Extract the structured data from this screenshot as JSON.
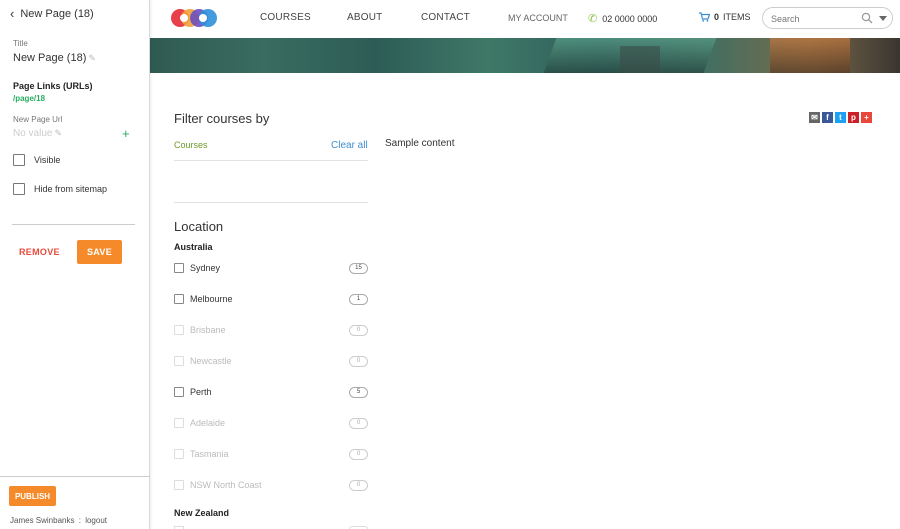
{
  "sidebar": {
    "back_label": "New Page (18)",
    "title_label": "Title",
    "title_value": "New Page (18)",
    "page_links_heading": "Page Links (URLs)",
    "page_link_path": "/page/18",
    "new_url_label": "New Page Url",
    "new_url_placeholder": "No value",
    "add_icon": "plus-icon",
    "visible_label": "Visible",
    "visible_checked": false,
    "hide_sitemap_label": "Hide from sitemap",
    "hide_sitemap_checked": false,
    "remove_label": "REMOVE",
    "save_label": "SAVE",
    "publish_label": "PUBLISH",
    "user_name": "James Swinbanks",
    "user_separator": ":",
    "logout_label": "logout"
  },
  "header": {
    "nav": [
      "COURSES",
      "ABOUT",
      "CONTACT"
    ],
    "my_account": "MY ACCOUNT",
    "phone": "02 0000 0000",
    "cart_count": "0",
    "cart_label": "ITEMS",
    "search_placeholder": "Search"
  },
  "filter": {
    "title": "Filter courses by",
    "subtitle": "Courses",
    "clear_all": "Clear all",
    "location_title": "Location",
    "regions": [
      {
        "name": "Australia",
        "locations": [
          {
            "name": "Sydney",
            "count": "15",
            "enabled": true
          },
          {
            "name": "Melbourne",
            "count": "1",
            "enabled": true
          },
          {
            "name": "Brisbane",
            "count": "0",
            "enabled": false
          },
          {
            "name": "Newcastle",
            "count": "0",
            "enabled": false
          },
          {
            "name": "Perth",
            "count": "5",
            "enabled": true
          },
          {
            "name": "Adelaide",
            "count": "0",
            "enabled": false
          },
          {
            "name": "Tasmania",
            "count": "0",
            "enabled": false
          },
          {
            "name": "NSW North Coast",
            "count": "0",
            "enabled": false
          }
        ]
      },
      {
        "name": "New Zealand",
        "locations": []
      }
    ]
  },
  "content": {
    "sample_text": "Sample content"
  },
  "share_icons": [
    {
      "icon": "email-icon",
      "glyph": "✉",
      "color": "#666666"
    },
    {
      "icon": "facebook-icon",
      "glyph": "f",
      "color": "#3b5998"
    },
    {
      "icon": "twitter-icon",
      "glyph": "t",
      "color": "#1da1f2"
    },
    {
      "icon": "pinterest-icon",
      "glyph": "p",
      "color": "#cb2027"
    },
    {
      "icon": "more-share-icon",
      "glyph": "+",
      "color": "#e8483b"
    }
  ],
  "colors": {
    "accent_orange": "#f58a2a",
    "remove_red": "#e74c3c",
    "link_green": "#27ae60",
    "link_blue": "#3d8ed0"
  }
}
